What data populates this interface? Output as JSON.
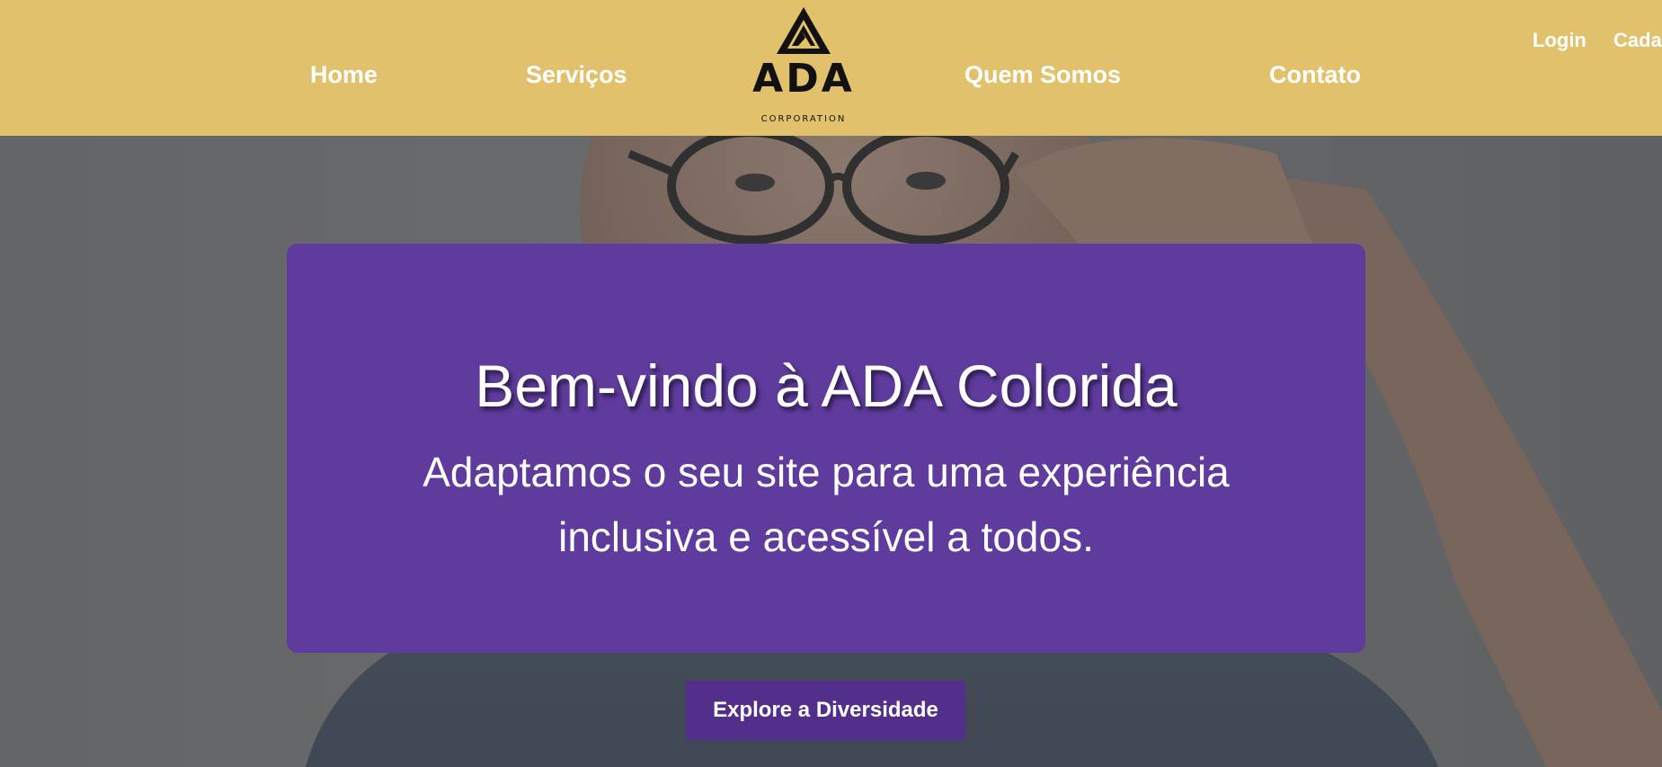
{
  "header": {
    "background_color": "#e2c16d",
    "nav": [
      {
        "label": "Home"
      },
      {
        "label": "Serviços"
      },
      {
        "label": "Quem Somos"
      },
      {
        "label": "Contato"
      }
    ],
    "logo": {
      "icon": "ada-triangle-logo-icon",
      "title": "ADA",
      "subtitle": "CORPORATION"
    },
    "auth": {
      "login_label": "Login",
      "register_label": "Cada"
    }
  },
  "hero": {
    "image": "man-with-glasses-photo",
    "card": {
      "background_color": "#5e3b9c",
      "title": "Bem-vindo à ADA Colorida",
      "text": "Adaptamos o seu site para uma experiência inclusiva e acessível a todos."
    },
    "cta": {
      "label": "Explore a Diversidade",
      "background_color": "#532f8c"
    }
  }
}
